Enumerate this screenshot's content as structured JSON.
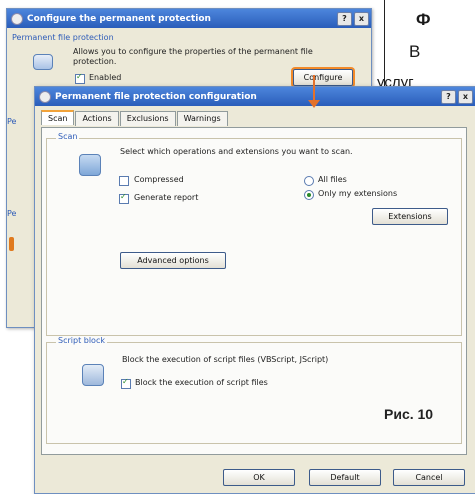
{
  "article": {
    "fragment_1": "Ф",
    "fragment_2": "В",
    "fragment_3": "услуг",
    "caption": "Рис. 10"
  },
  "back_window": {
    "title": "Configure the permanent protection",
    "help_btn": "?",
    "close_btn": "x",
    "group_title": "Permanent file protection",
    "description": "Allows you to configure the properties of the permanent file protection.",
    "enabled_label": "Enabled",
    "enabled_checked": true,
    "configure_button": "Configure",
    "side_label_1": "Pe",
    "side_label_2": "Pe"
  },
  "front_window": {
    "title": "Permanent file protection configuration",
    "help_btn": "?",
    "close_btn": "x",
    "tabs": [
      {
        "label": "Scan",
        "active": true
      },
      {
        "label": "Actions",
        "active": false
      },
      {
        "label": "Exclusions",
        "active": false
      },
      {
        "label": "Warnings",
        "active": false
      }
    ],
    "scan": {
      "group_title": "Scan",
      "instruction": "Select which operations and extensions you want to scan.",
      "compressed_label": "Compressed",
      "compressed_checked": false,
      "report_label": "Generate report",
      "report_checked": true,
      "all_files_label": "All files",
      "my_ext_label": "Only my extensions",
      "selected_radio": "Only my extensions",
      "extensions_button": "Extensions",
      "advanced_button": "Advanced options"
    },
    "script_block": {
      "group_title": "Script block",
      "instruction": "Block the execution of script files (VBScript, JScript)",
      "block_label": "Block the execution of script files",
      "block_checked": true
    },
    "footer": {
      "ok": "OK",
      "default": "Default",
      "cancel": "Cancel"
    }
  },
  "colors": {
    "title_bar": "#2a5dba",
    "highlight": "#f28a2a",
    "group_title": "#2e5cb8",
    "check": "#2a8a2a"
  }
}
